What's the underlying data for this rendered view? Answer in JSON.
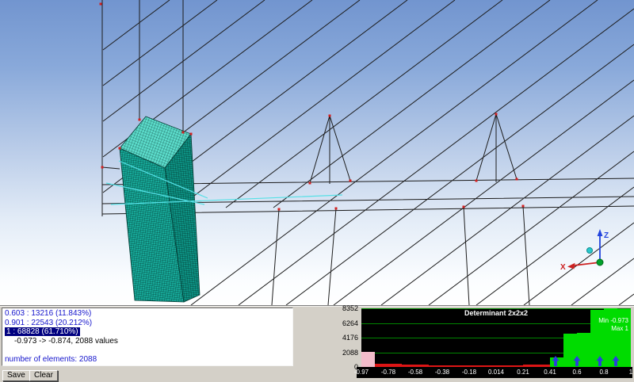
{
  "viewport": {
    "axis_triad": {
      "x_label": "X",
      "z_label": "Z"
    },
    "mesh_color": "#17aa9a"
  },
  "log_panel": {
    "lines": [
      {
        "text": "0.603 : 13216 (11.843%)",
        "style": "blue"
      },
      {
        "text": "0.901 : 22543 (20.212%)",
        "style": "blue"
      },
      {
        "text": "1 : 68828 (61.710%)",
        "style": "highlight"
      },
      {
        "text": "-0.973 -> -0.874, 2088 values",
        "style": "black-indent"
      },
      {
        "text": "",
        "style": "blank"
      },
      {
        "text": "number of elements: 2088",
        "style": "blue"
      }
    ]
  },
  "buttons": {
    "save": "Save",
    "clear": "Clear"
  },
  "chart_data": {
    "type": "bar",
    "title": "Determinant 2x2x2",
    "xlabel": "",
    "ylabel": "",
    "xlim": [
      -0.973,
      1
    ],
    "ylim": [
      0,
      8352
    ],
    "y_ticks": [
      0,
      2088,
      4176,
      6264,
      8352
    ],
    "x_tick_labels": [
      "-0.97",
      "-0.78",
      "-0.58",
      "-0.38",
      "-0.18",
      "0.014",
      "0.21",
      "0.41",
      "0.6",
      "0.8",
      "1"
    ],
    "values": [
      2088,
      480,
      400,
      340,
      300,
      270,
      250,
      240,
      230,
      230,
      240,
      260,
      290,
      330,
      1300,
      4700,
      4900,
      8100,
      8352,
      8250
    ],
    "bar_colors": [
      "pink",
      "red",
      "red",
      "red",
      "red",
      "red",
      "red",
      "red",
      "red",
      "red",
      "red",
      "red",
      "red",
      "red",
      "green",
      "green",
      "green",
      "green",
      "green",
      "green"
    ],
    "palette": {
      "pink": "#f2bcca",
      "red": "#dd1515",
      "green": "#00dc00",
      "grid": "#008400",
      "plot_bg": "#000000"
    },
    "selected_bin": {
      "range": "-0.973 -> -0.874",
      "count": 2088
    },
    "annotations": {
      "min": "Min -0.973",
      "max": "Max 1"
    },
    "marker_fractions": [
      0.72,
      0.8,
      0.885,
      0.944
    ],
    "legend": "none",
    "grid": "horizontal"
  }
}
